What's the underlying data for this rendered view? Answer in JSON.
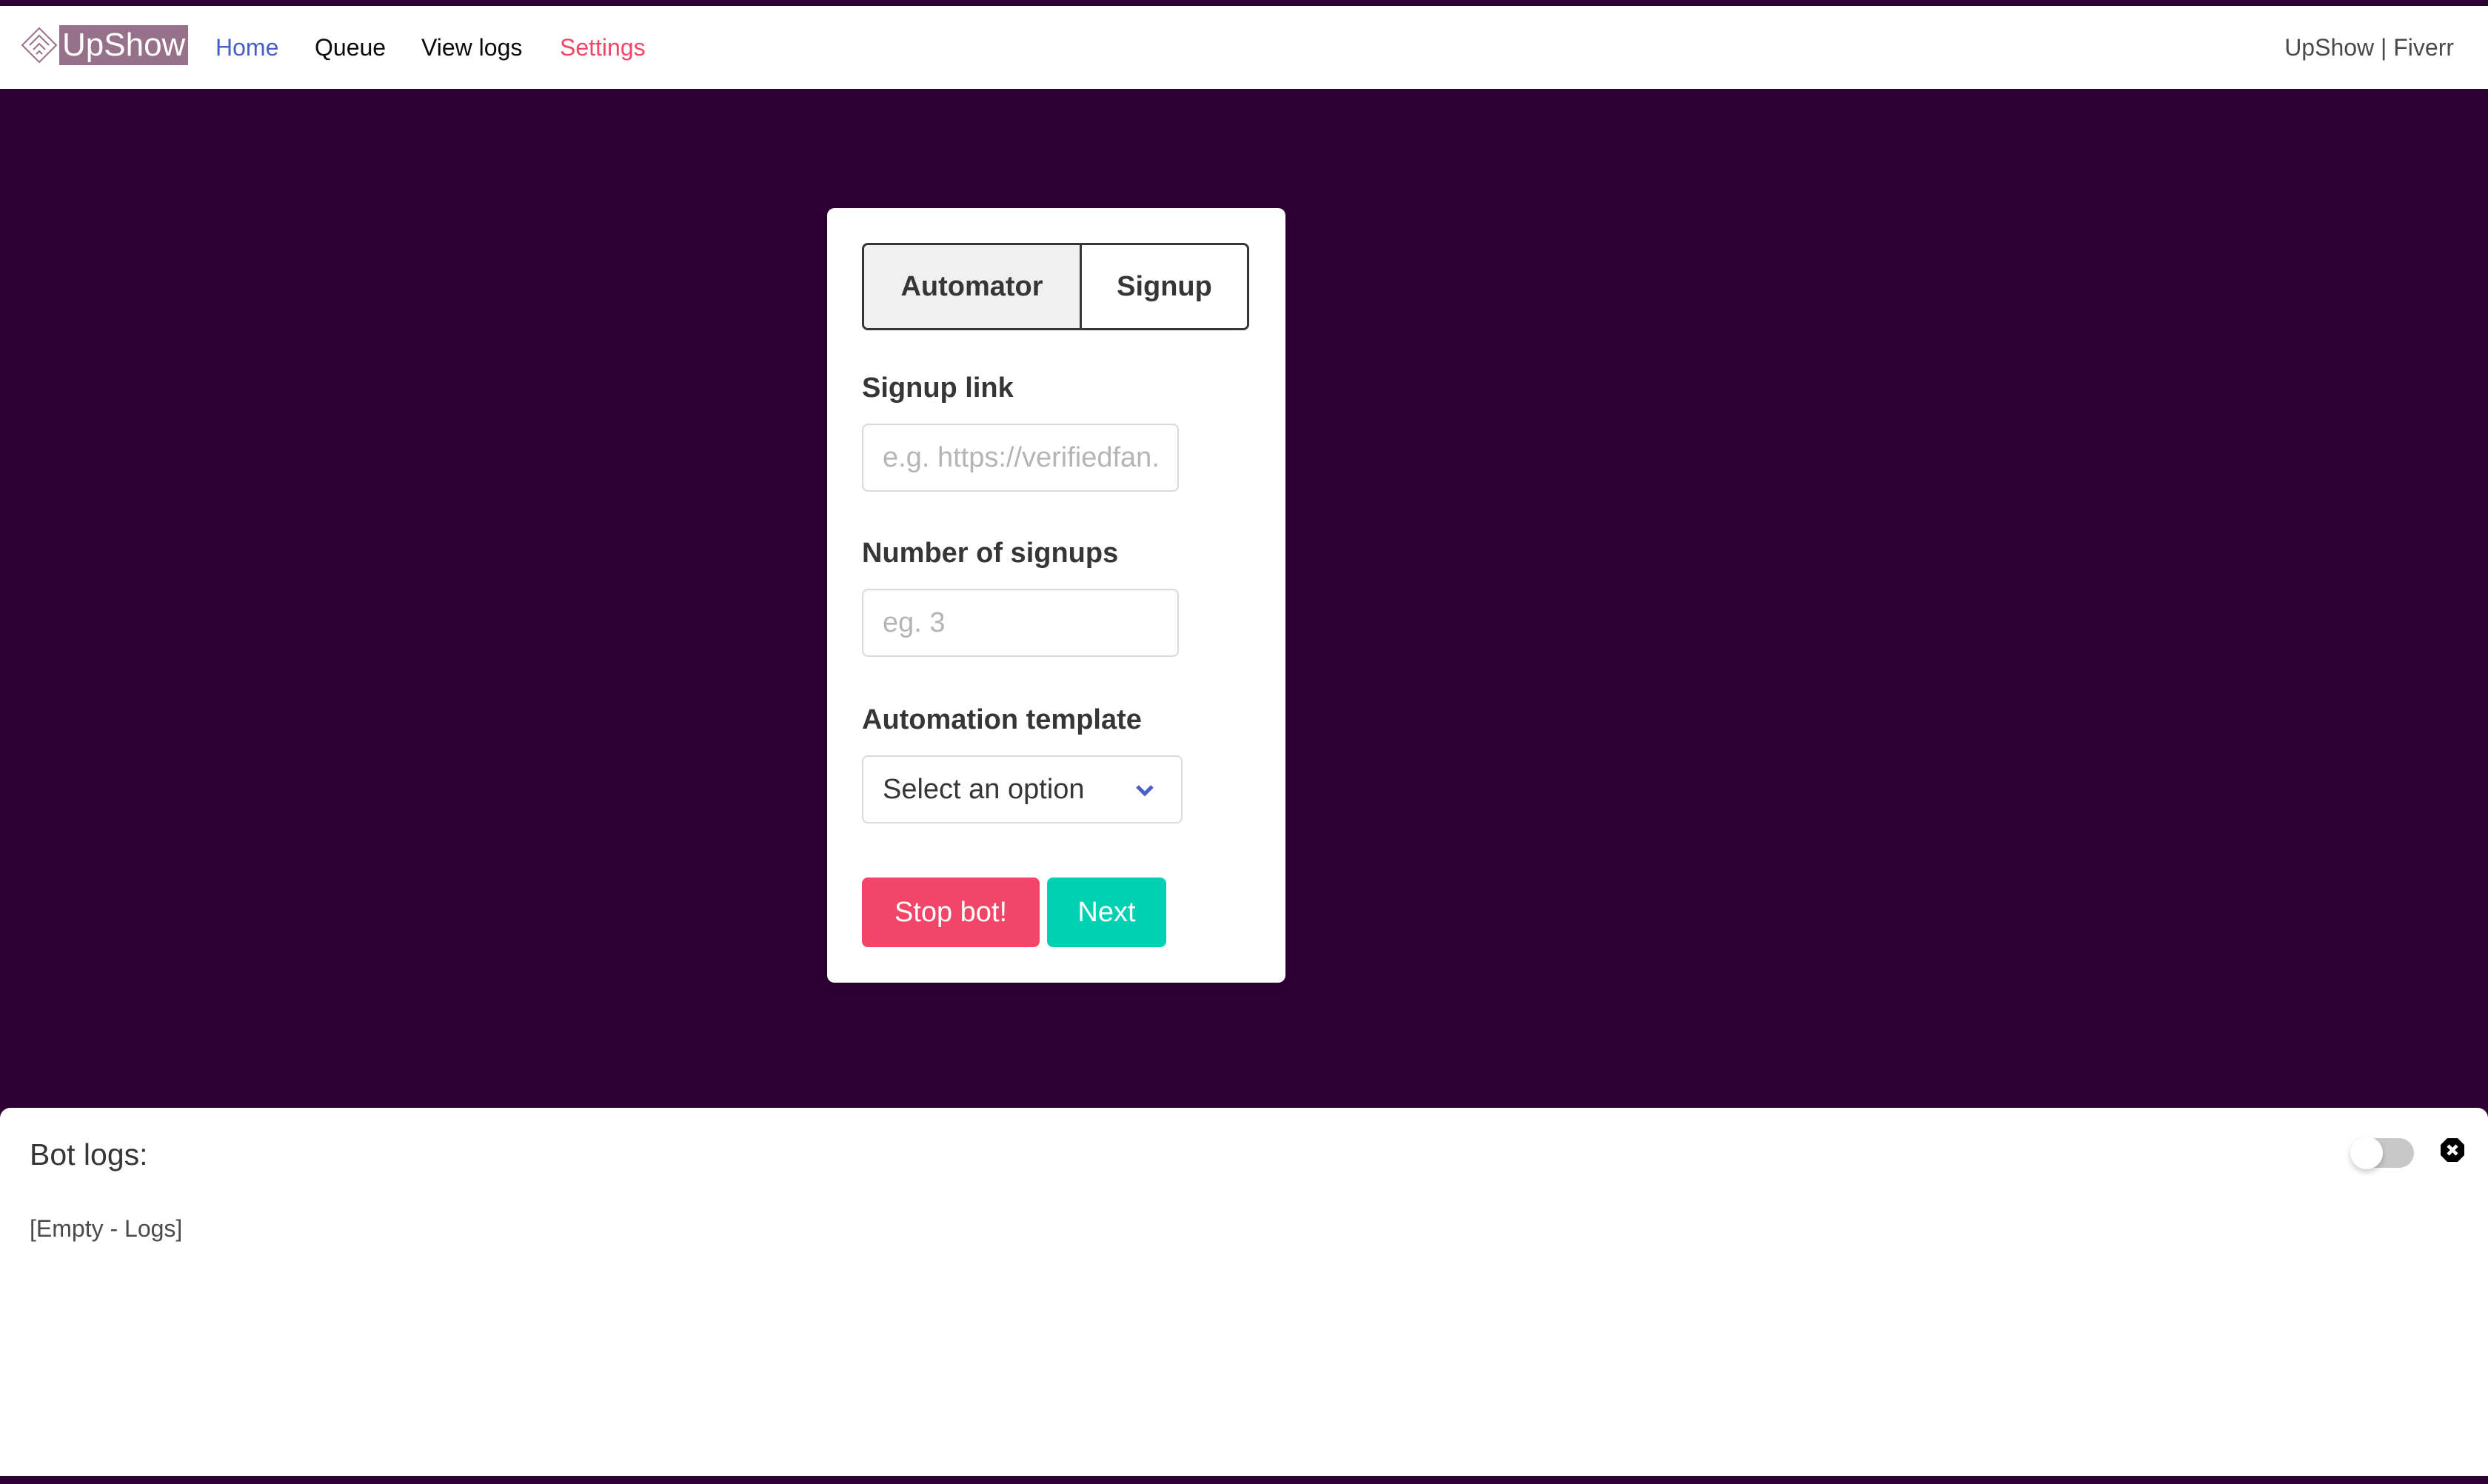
{
  "nav": {
    "logo": "UpShow",
    "links": [
      {
        "label": "Home",
        "color": "#485fc7"
      },
      {
        "label": "Queue",
        "color": "#0a0a0a"
      },
      {
        "label": "View logs",
        "color": "#0a0a0a"
      },
      {
        "label": "Settings",
        "color": "#f14668"
      }
    ],
    "right": "UpShow | Fiverr"
  },
  "form": {
    "tabs": [
      "Automator",
      "Signup"
    ],
    "active_tab": "Automator",
    "signup_link": {
      "label": "Signup link",
      "placeholder": "e.g. https://verifiedfan...",
      "value": ""
    },
    "num_signups": {
      "label": "Number of signups",
      "placeholder": "eg. 3",
      "value": ""
    },
    "template": {
      "label": "Automation template",
      "selected": "Select an option"
    },
    "stop_button": "Stop bot!",
    "next_button": "Next"
  },
  "logs": {
    "title": "Bot logs:",
    "content": "[Empty - Logs]",
    "toggle_on": false
  },
  "colors": {
    "background": "#2e0135",
    "danger": "#f14668",
    "primary": "#00d1b2",
    "link": "#485fc7"
  }
}
